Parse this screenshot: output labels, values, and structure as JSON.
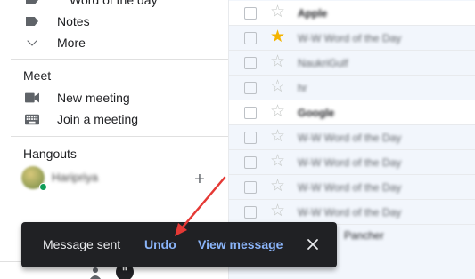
{
  "sidebar": {
    "labels": [
      {
        "label": "Word of the day",
        "icon": "label-icon"
      },
      {
        "label": "Notes",
        "icon": "label-icon"
      },
      {
        "label": "More",
        "icon": "chevron-down-icon"
      }
    ],
    "meet": {
      "title": "Meet",
      "items": [
        {
          "label": "New meeting",
          "icon": "video-camera-icon"
        },
        {
          "label": "Join a meeting",
          "icon": "keyboard-icon"
        }
      ]
    },
    "hangouts": {
      "title": "Hangouts",
      "contact_name": "Haripriya",
      "add_icon": "plus-icon"
    }
  },
  "email_list": {
    "rows": [
      {
        "sender": "Apple",
        "starred": false,
        "unread": true
      },
      {
        "sender": "W-W Word of the Day",
        "starred": true,
        "unread": false
      },
      {
        "sender": "NaukriGulf",
        "starred": false,
        "unread": false
      },
      {
        "sender": "hr",
        "starred": false,
        "unread": false
      },
      {
        "sender": "Google",
        "starred": false,
        "unread": true
      },
      {
        "sender": "W-W Word of the Day",
        "starred": false,
        "unread": false
      },
      {
        "sender": "W-W Word of the Day",
        "starred": false,
        "unread": false
      },
      {
        "sender": "W-W Word of the Day",
        "starred": false,
        "unread": false
      },
      {
        "sender": "W-W Word of the Day",
        "starred": false,
        "unread": false
      }
    ],
    "partial_row_text": "Pancher"
  },
  "snackbar": {
    "message": "Message sent",
    "undo_label": "Undo",
    "view_label": "View message",
    "close_icon": "close-icon"
  },
  "colors": {
    "snackbar_bg": "#202124",
    "link_blue": "#8ab4f8",
    "star_yellow": "#f4b400",
    "annotation_red": "#e53935"
  }
}
